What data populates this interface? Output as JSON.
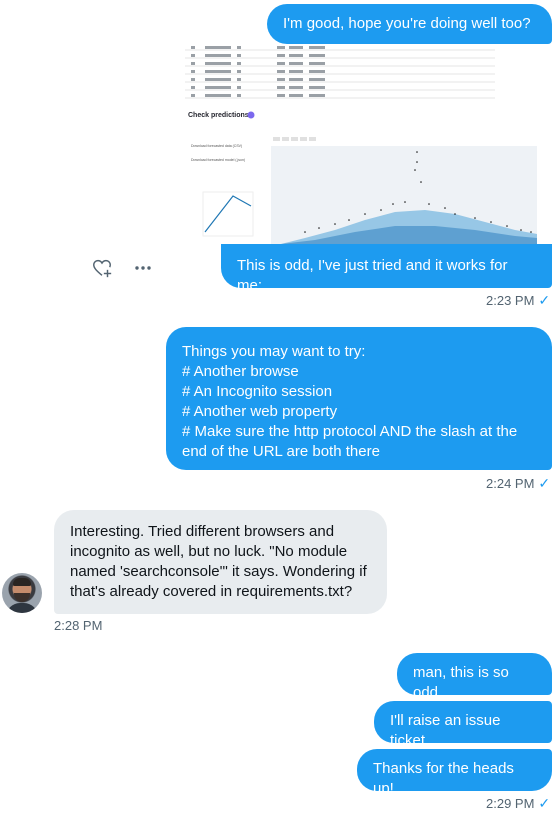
{
  "messages": [
    {
      "text": "I'm good, hope you're doing well too?"
    },
    {
      "text": "This is odd, I've just tried and it works for me:"
    },
    {
      "lines": [
        "Things you may want to try:",
        "# Another browse",
        "# An Incognito session",
        "# Another web property",
        "# Make sure the http protocol AND the slash at the end of the URL are both there"
      ]
    },
    {
      "text": "Interesting. Tried different browsers and incognito as well, but no luck. \"No module named 'searchconsole'\" it says. Wondering if that's already covered in requirements.txt?"
    },
    {
      "text": "man, this is so odd"
    },
    {
      "text": "I'll raise an issue ticket"
    },
    {
      "text": "Thanks for the heads up!"
    }
  ],
  "timestamps": {
    "t1": "2:23 PM",
    "t2": "2:24 PM",
    "t3": "2:28 PM",
    "t4": "2:29 PM"
  },
  "screenshot": {
    "heading": "Check predictions",
    "link1": "Download forecasted data (CSV)",
    "link2": "Download forecasted model (.json)"
  },
  "icons": {
    "react": "heart-plus-icon",
    "more": "more-horizontal-icon",
    "sent": "checkmark-icon"
  },
  "colors": {
    "outgoing_bubble": "#1d9bf0",
    "incoming_bubble": "#e8ecef",
    "meta_text": "#536471"
  }
}
